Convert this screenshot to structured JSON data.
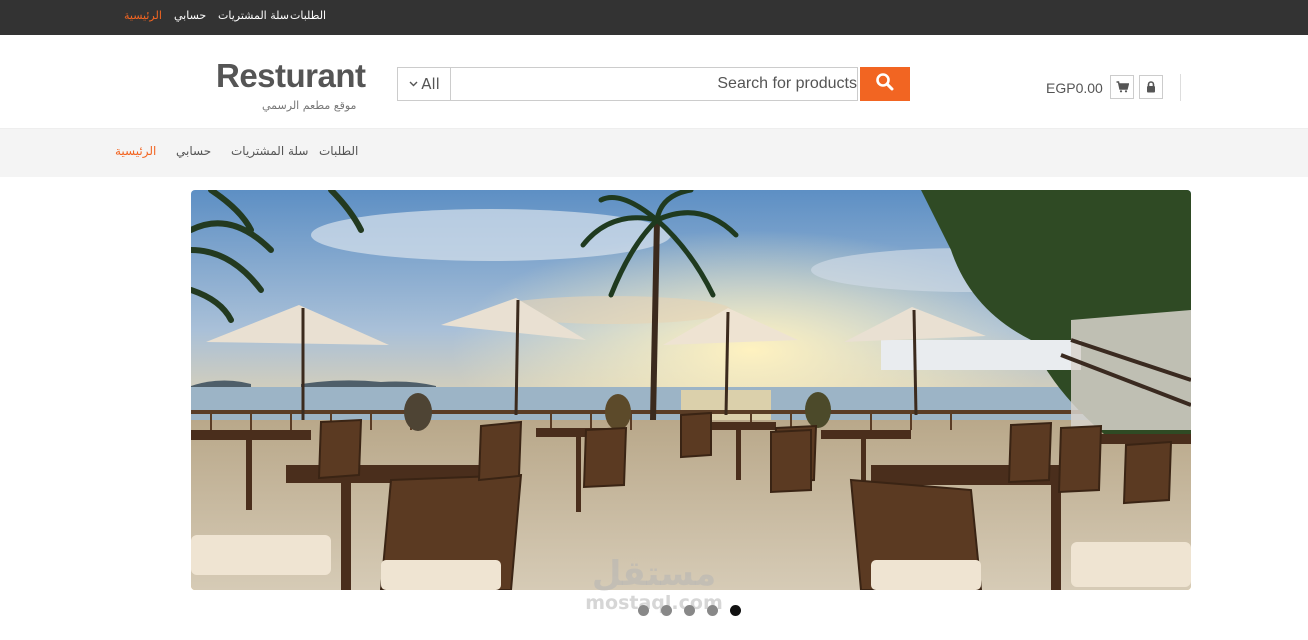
{
  "top_menu": {
    "items": [
      "الطلبات",
      "سلة المشتريات",
      "حسابي",
      "الرئيسية"
    ],
    "active": "الرئيسية"
  },
  "site": {
    "title": "Resturant",
    "tagline": "موقع مطعم الرسمي"
  },
  "search": {
    "category": "All",
    "placeholder": "Search for products",
    "value": ""
  },
  "cart": {
    "total": "EGP0.00"
  },
  "main_nav": {
    "items": [
      "الطلبات",
      "سلة المشتريات",
      "حسابي",
      "الرئيسية"
    ],
    "active": "الرئيسية"
  },
  "slider": {
    "slide_count": 5,
    "active_index": 4
  },
  "watermark": {
    "arabic": "مستقل",
    "latin": "mostaql.com"
  },
  "colors": {
    "accent": "#f26522",
    "topbar": "#333333",
    "navbar": "#f4f4f4"
  }
}
